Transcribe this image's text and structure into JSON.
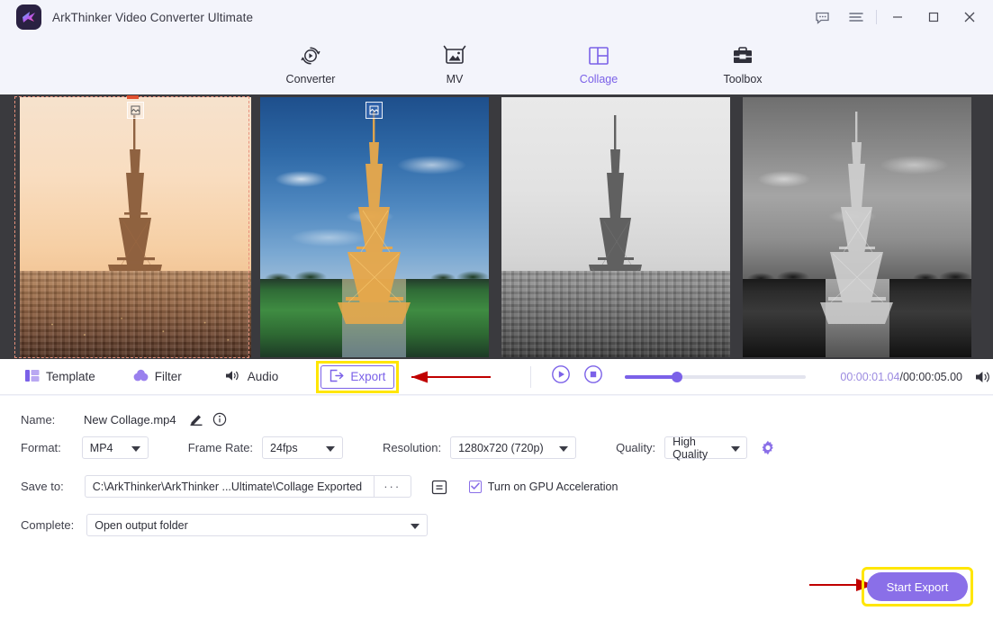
{
  "window": {
    "app_title": "ArkThinker Video Converter Ultimate",
    "logo_icon": "app-logo-icon",
    "feedback_icon": "chat-bubble-icon",
    "menu_icon": "hamburger-menu-icon",
    "minimize_label": "—",
    "maximize_label": "▢",
    "close_label": "✕"
  },
  "nav": {
    "tabs": [
      {
        "label": "Converter",
        "icon": "converter-icon",
        "active": false
      },
      {
        "label": "MV",
        "icon": "mv-icon",
        "active": false
      },
      {
        "label": "Collage",
        "icon": "collage-icon",
        "active": true
      },
      {
        "label": "Toolbox",
        "icon": "toolbox-icon",
        "active": false
      }
    ],
    "active_color": "#7b61e8"
  },
  "preview": {
    "cells": [
      {
        "name": "eiffel-tower-sunset",
        "selected": true,
        "badge_icon": "crop-badge-icon"
      },
      {
        "name": "eiffel-tower-night-blue",
        "selected": false,
        "badge_icon": "crop-badge-icon"
      },
      {
        "name": "eiffel-tower-grayscale-day",
        "selected": false,
        "badge_icon": ""
      },
      {
        "name": "eiffel-tower-grayscale-night",
        "selected": false,
        "badge_icon": ""
      }
    ]
  },
  "toolbar": {
    "template_label": "Template",
    "template_icon": "template-icon",
    "filter_label": "Filter",
    "filter_icon": "filter-droplets-icon",
    "audio_label": "Audio",
    "audio_icon": "speaker-icon",
    "export_label": "Export",
    "export_icon": "export-arrow-icon",
    "export_highlight_color": "#ffe600",
    "arrow_color": "#c00000",
    "play_icon": "play-circle-icon",
    "stop_icon": "stop-circle-icon",
    "volume_icon": "volume-icon",
    "time_current": "00:00:01.04",
    "time_separator": "/",
    "time_total": "00:00:05.00",
    "progress_percent": 21
  },
  "form": {
    "name_label": "Name:",
    "name_value": "New Collage.mp4",
    "edit_icon": "pencil-icon",
    "info_icon": "info-circle-icon",
    "format_label": "Format:",
    "format_value": "MP4",
    "framerate_label": "Frame Rate:",
    "framerate_value": "24fps",
    "resolution_label": "Resolution:",
    "resolution_value": "1280x720 (720p)",
    "quality_label": "Quality:",
    "quality_value": "High Quality",
    "settings_gear_icon": "gear-icon",
    "saveto_label": "Save to:",
    "saveto_value": "C:\\ArkThinker\\ArkThinker ...Ultimate\\Collage Exported",
    "browse_label": "···",
    "folder_icon": "open-folder-icon",
    "gpu_label": "Turn on GPU Acceleration",
    "gpu_checked": true,
    "gpu_check_icon": "checkmark-icon",
    "complete_label": "Complete:",
    "complete_value": "Open output folder",
    "start_export_label": "Start Export",
    "start_export_highlight_color": "#ffe600",
    "start_export_bg": "#8a6fe8"
  }
}
